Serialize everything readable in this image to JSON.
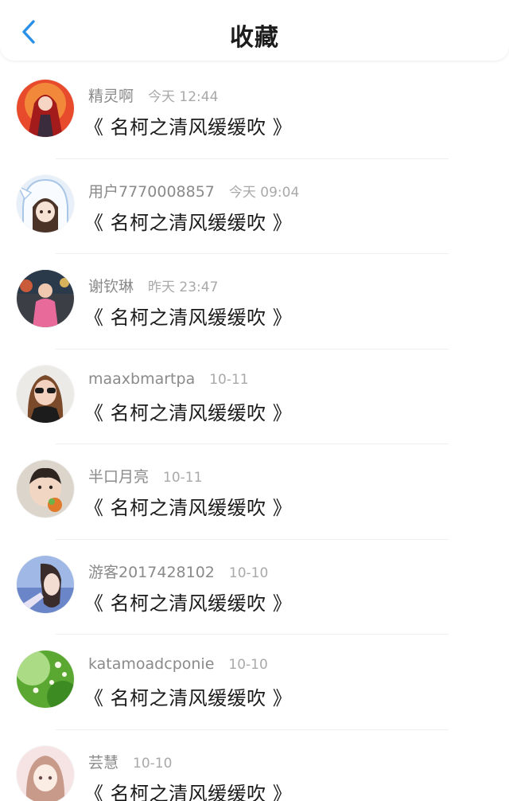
{
  "header": {
    "title": "收藏",
    "back_icon": "chevron-left-icon",
    "accent": "#2a8fe6"
  },
  "favorites": [
    {
      "user": "精灵啊",
      "time": "今天 12:44",
      "title": "《 名柯之清风缓缓吹 》",
      "avatar": "anime-girl-red-avatar"
    },
    {
      "user": "用户7770008857",
      "time": "今天 09:04",
      "title": "《 名柯之清风缓缓吹 》",
      "avatar": "anime-girl-bunny-hood-avatar"
    },
    {
      "user": "谢钦琳",
      "time": "昨天 23:47",
      "title": "《 名柯之清风缓缓吹 》",
      "avatar": "person-pink-avatar"
    },
    {
      "user": "maaxbmartpa",
      "time": "10-11",
      "title": "《 名柯之清风缓缓吹 》",
      "avatar": "girl-sunglasses-avatar"
    },
    {
      "user": "半口月亮",
      "time": "10-11",
      "title": "《 名柯之清风缓缓吹 》",
      "avatar": "baby-photo-avatar"
    },
    {
      "user": "游客2017428102",
      "time": "10-10",
      "title": "《 名柯之清风缓缓吹 》",
      "avatar": "blue-portrait-avatar"
    },
    {
      "user": "katamoadcponie",
      "time": "10-10",
      "title": "《 名柯之清风缓缓吹 》",
      "avatar": "green-flowers-avatar"
    },
    {
      "user": "芸慧",
      "time": "10-10",
      "title": "《 名柯之清风缓缓吹 》",
      "avatar": "anime-girl-pink-avatar"
    }
  ]
}
